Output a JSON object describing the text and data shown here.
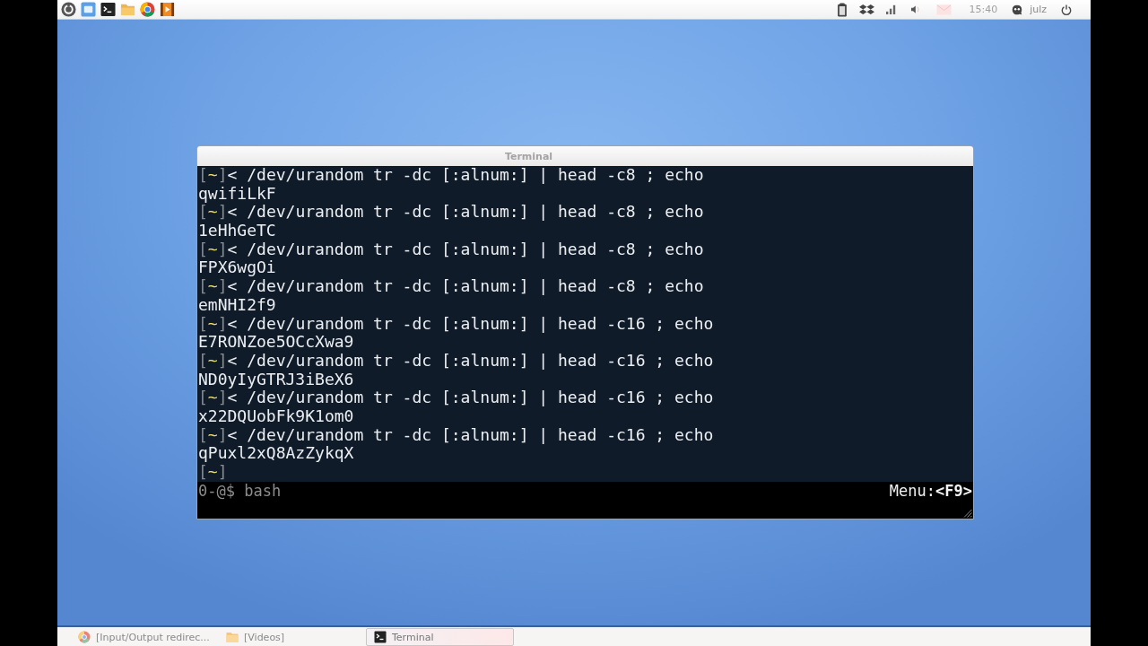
{
  "top_panel": {
    "clock": "15:40",
    "user": "julz"
  },
  "terminal": {
    "title": "Terminal",
    "lines": [
      {
        "kind": "command",
        "prompt": {
          "left": "[",
          "dir": "~",
          "right": "]"
        },
        "text": "< /dev/urandom tr -dc [:alnum:] | head -c8 ; echo"
      },
      {
        "kind": "output",
        "text": "qwifiLkF"
      },
      {
        "kind": "command",
        "prompt": {
          "left": "[",
          "dir": "~",
          "right": "]"
        },
        "text": "< /dev/urandom tr -dc [:alnum:] | head -c8 ; echo"
      },
      {
        "kind": "output",
        "text": "1eHhGeTC"
      },
      {
        "kind": "command",
        "prompt": {
          "left": "[",
          "dir": "~",
          "right": "]"
        },
        "text": "< /dev/urandom tr -dc [:alnum:] | head -c8 ; echo"
      },
      {
        "kind": "output",
        "text": "FPX6wgOi"
      },
      {
        "kind": "command",
        "prompt": {
          "left": "[",
          "dir": "~",
          "right": "]"
        },
        "text": "< /dev/urandom tr -dc [:alnum:] | head -c8 ; echo"
      },
      {
        "kind": "output",
        "text": "emNHI2f9"
      },
      {
        "kind": "command",
        "prompt": {
          "left": "[",
          "dir": "~",
          "right": "]"
        },
        "text": "< /dev/urandom tr -dc [:alnum:] | head -c16 ; echo"
      },
      {
        "kind": "output",
        "text": "E7RONZoe5OCcXwa9"
      },
      {
        "kind": "command",
        "prompt": {
          "left": "[",
          "dir": "~",
          "right": "]"
        },
        "text": "< /dev/urandom tr -dc [:alnum:] | head -c16 ; echo"
      },
      {
        "kind": "output",
        "text": "ND0yIyGTRJ3iBeX6"
      },
      {
        "kind": "command",
        "prompt": {
          "left": "[",
          "dir": "~",
          "right": "]"
        },
        "text": "< /dev/urandom tr -dc [:alnum:] | head -c16 ; echo"
      },
      {
        "kind": "output",
        "text": "x22DQUobFk9K1om0"
      },
      {
        "kind": "command",
        "prompt": {
          "left": "[",
          "dir": "~",
          "right": "]"
        },
        "text": "< /dev/urandom tr -dc [:alnum:] | head -c16 ; echo"
      },
      {
        "kind": "output",
        "text": "qPuxl2xQ8AzZykqX"
      },
      {
        "kind": "prompt",
        "prompt": {
          "left": "[",
          "dir": "~",
          "right": "]"
        }
      }
    ],
    "status_bar": {
      "session": "0-@$ bash",
      "menu_hint": "Menu:**<F9>**"
    }
  },
  "taskbar": [
    {
      "kind": "browser",
      "label": "[Input/Output redirec...",
      "selected": false
    },
    {
      "kind": "folder",
      "label": "[Videos]",
      "selected": false
    },
    {
      "kind": "terminal",
      "label": "Terminal",
      "selected": true
    }
  ]
}
